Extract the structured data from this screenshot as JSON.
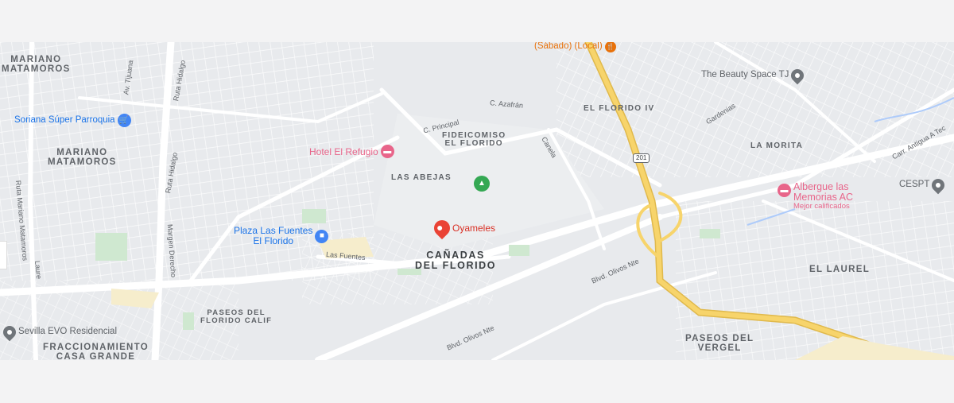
{
  "map": {
    "areas": {
      "mariano_matamoros_top": "MARIANO\nMATAMOROS",
      "mariano_matamoros_mid": "MARIANO\nMATAMOROS",
      "fideicomiso": "FIDEICOMISO\nEL FLORIDO",
      "las_abejas": "LAS ABEJAS",
      "el_florido_iv": "EL FLORIDO IV",
      "la_morita": "LA MORITA",
      "canadas": "CAÑADAS\nDEL FLORIDO",
      "paseos_florido": "PASEOS DEL\nFLORIDO CALIF",
      "fraccionamiento": "FRACCIONAMIENTO\nCASA GRANDE",
      "el_laurel": "EL LAUREL",
      "paseos_vergel": "PASEOS DEL\nVERGEL"
    },
    "streets": {
      "c_azafran": "C. Azafrán",
      "c_principal": "C. Principal",
      "canela": "Canela",
      "las_fuentes": "Las Fuentes",
      "blvd_olivos_1": "Blvd. Olivos Nte",
      "blvd_olivos_2": "Blvd. Olivos Nte",
      "gardenias": "Gardenias",
      "carr_antigua": "Carr. Antigua A Tec",
      "ruta_hidalgo": "Ruta Hidalgo",
      "ruta_hidalgo2": "Ruta Hidalgo",
      "margen_derecho": "Margen Derecho",
      "ruta_mariano": "Ruta Mariano Matamoros",
      "lauro": "Laure",
      "av_tijuana": "Av. Tijuana",
      "highway_shield": "201"
    },
    "pois": {
      "sabado_local": "(Sábado) (Local)",
      "beauty_space": "The Beauty Space TJ",
      "soriana": "Soriana Súper Parroquia",
      "hotel_refugio": "Hotel El Refugio",
      "oyameles": "Oyameles",
      "plaza_fuentes": "Plaza Las Fuentes\nEl Florido",
      "albergue": "Albergue las\nMemorias AC",
      "albergue_sub": "Mejor calificados",
      "cespt": "CESPT",
      "sevilla": "Sevilla EVO Residencial"
    },
    "colors": {
      "background": "#e8eaed",
      "road": "#ffffff",
      "highway": "#f7d46b",
      "pin_red": "#ea4335",
      "shopping_blue": "#4285f4",
      "hotel_pink": "#e8658a",
      "park_green": "#34a853",
      "generic_grey": "#70757a"
    }
  }
}
